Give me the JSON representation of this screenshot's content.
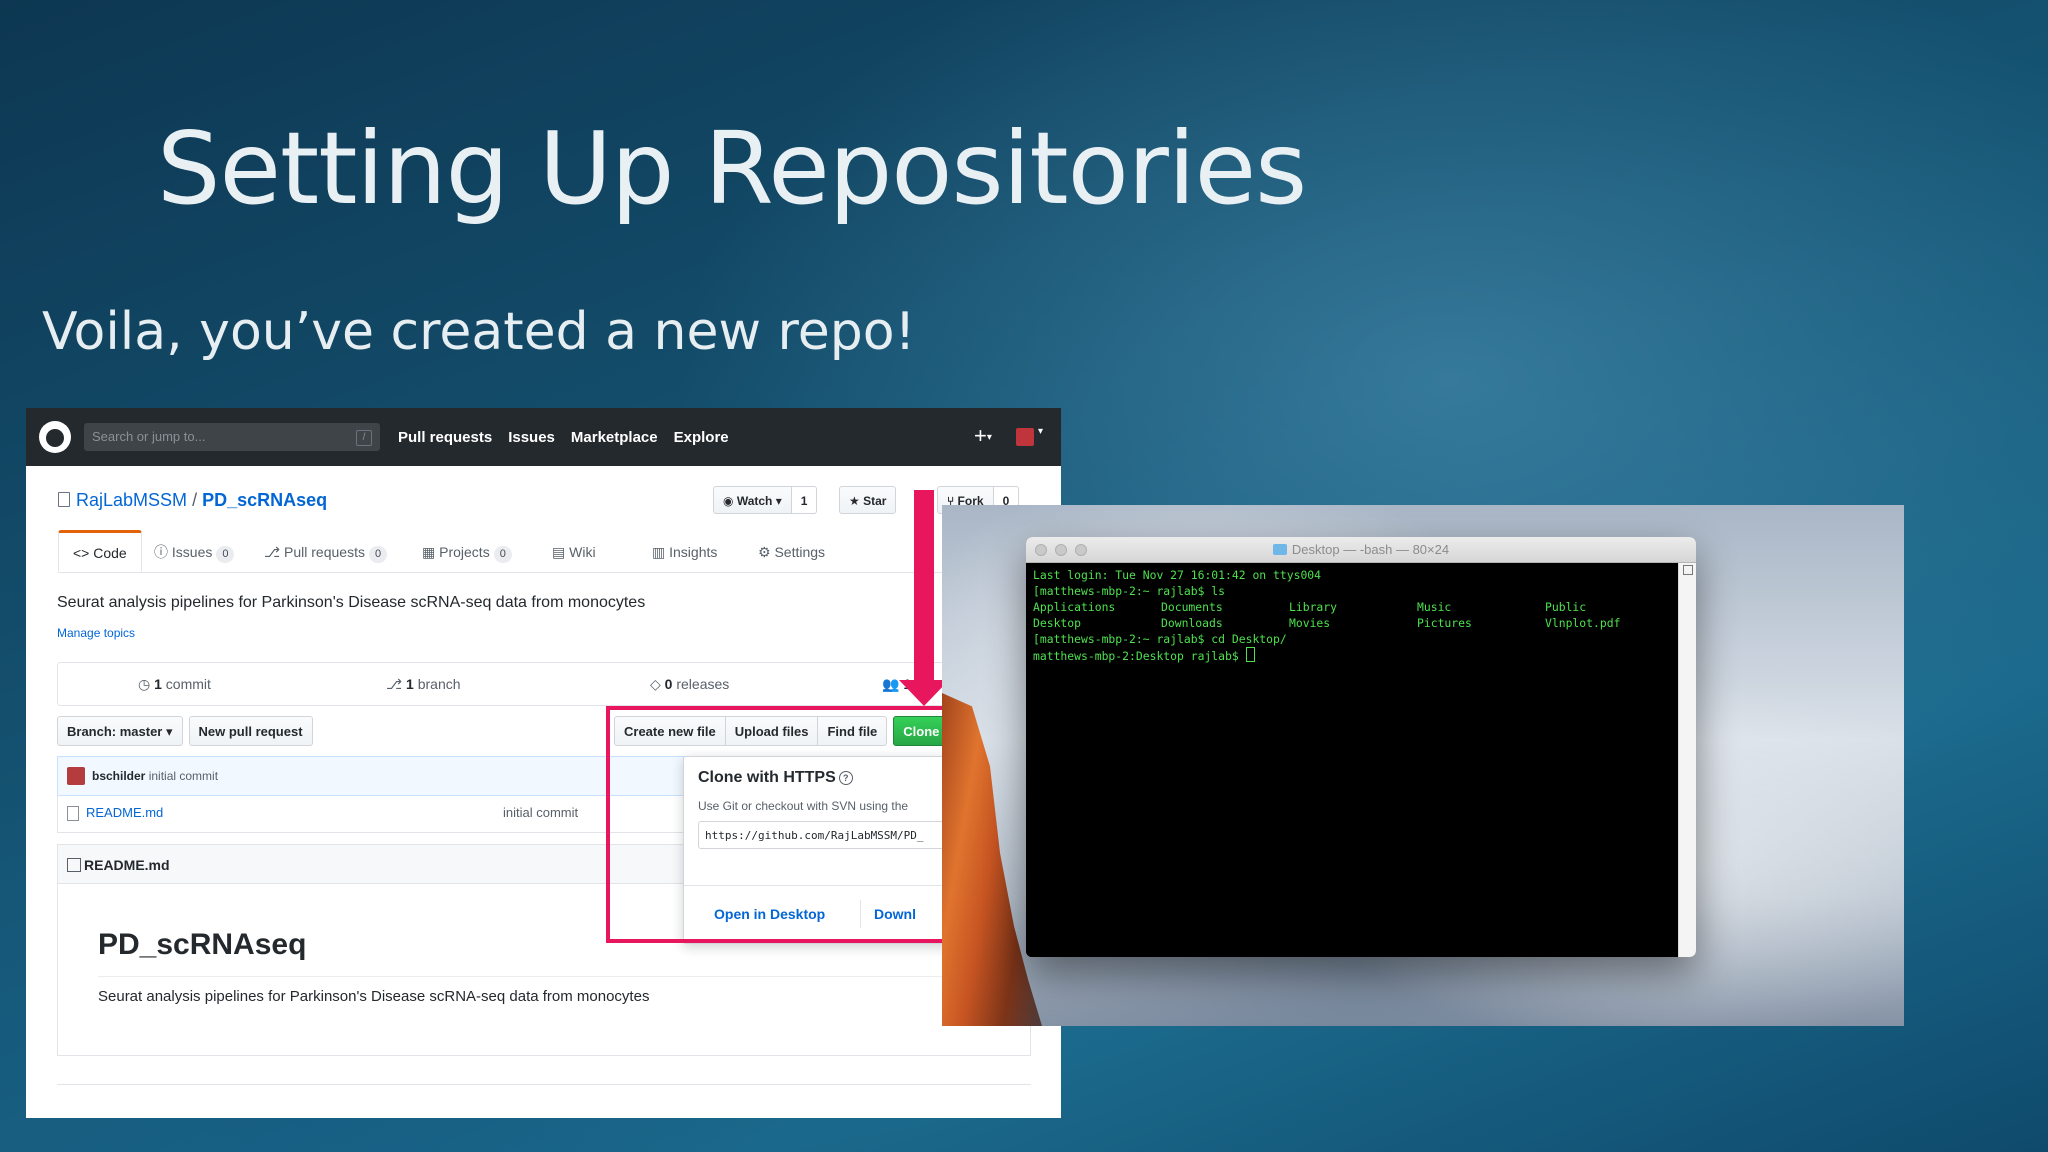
{
  "slide": {
    "title": "Setting Up Repositories",
    "subtitle": "Voila, you’ve created a new repo!"
  },
  "github": {
    "search_placeholder": "Search or jump to...",
    "search_key": "/",
    "nav_links": [
      "Pull requests",
      "Issues",
      "Marketplace",
      "Explore"
    ],
    "owner": "RajLabMSSM",
    "separator": "/",
    "repo": "PD_scRNAseq",
    "watch_label": "Watch ▾",
    "watch_count": "1",
    "star_label": "★ Star",
    "fork_label": "Fork",
    "fork_count": "0",
    "tabs": {
      "code": "<> Code",
      "issues": "Issues",
      "issues_count": "0",
      "pulls": "Pull requests",
      "pulls_count": "0",
      "projects": "Projects",
      "projects_count": "0",
      "wiki": "Wiki",
      "insights": "Insights",
      "settings": "Settings"
    },
    "description": "Seurat analysis pipelines for Parkinson's Disease scRNA-seq data from monocytes",
    "manage_topics": "Manage topics",
    "summary": {
      "commits_num": "1",
      "commits_label": "commit",
      "branches_num": "1",
      "branches_label": "branch",
      "releases_num": "0",
      "releases_label": "releases",
      "contributors_num": "1",
      "contributors_label": "co"
    },
    "branch_button": "Branch: master ▾",
    "new_pull_request": "New pull request",
    "create_new_file": "Create new file",
    "upload_files": "Upload files",
    "find_file": "Find file",
    "clone_button": "Clone o",
    "commit_author": "bschilder",
    "commit_message": "initial commit",
    "file_name": "README.md",
    "file_commit_message": "initial commit",
    "readme_header": "README.md",
    "readme_title": "PD_scRNAseq",
    "readme_text": "Seurat analysis pipelines for Parkinson's Disease scRNA-seq data from monocytes",
    "clone": {
      "title": "Clone with HTTPS",
      "help": "?",
      "subtitle": "Use Git or checkout with SVN using the",
      "url": "https://github.com/RajLabMSSM/PD_",
      "open_desktop": "Open in Desktop",
      "download": "Downl"
    }
  },
  "terminal": {
    "title": "Desktop — -bash — 80×24",
    "line1": "Last login: Tue Nov 27 16:01:42 on ttys004",
    "line2": "[matthews-mbp-2:~ rajlab$ ls",
    "ls_items": [
      "Applications",
      "Documents",
      "Library",
      "Music",
      "Public",
      "Desktop",
      "Downloads",
      "Movies",
      "Pictures",
      "Vlnplot.pdf"
    ],
    "line3": "[matthews-mbp-2:~ rajlab$ cd Desktop/",
    "line4": "matthews-mbp-2:Desktop rajlab$ "
  },
  "colors": {
    "annotation": "#e8175d",
    "terminal_text": "#4ee04e",
    "github_link": "#0366d6"
  }
}
